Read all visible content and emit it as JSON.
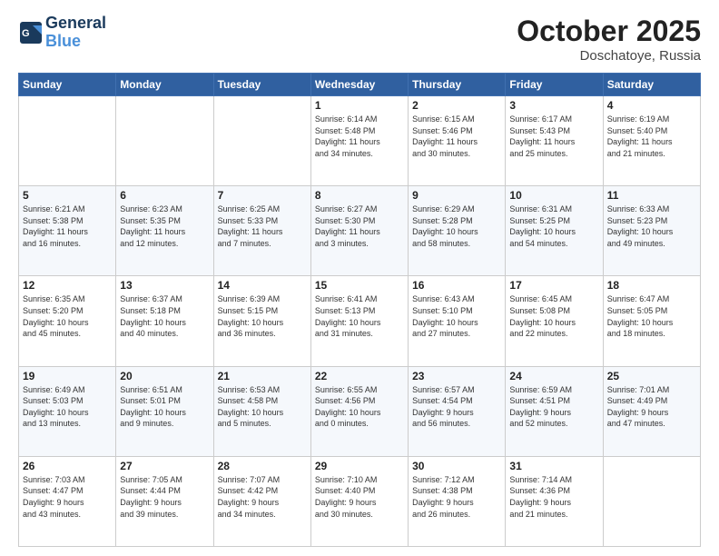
{
  "header": {
    "logo_line1": "General",
    "logo_line2": "Blue",
    "month": "October 2025",
    "location": "Doschatoye, Russia"
  },
  "weekdays": [
    "Sunday",
    "Monday",
    "Tuesday",
    "Wednesday",
    "Thursday",
    "Friday",
    "Saturday"
  ],
  "weeks": [
    [
      {
        "day": "",
        "info": ""
      },
      {
        "day": "",
        "info": ""
      },
      {
        "day": "",
        "info": ""
      },
      {
        "day": "1",
        "info": "Sunrise: 6:14 AM\nSunset: 5:48 PM\nDaylight: 11 hours\nand 34 minutes."
      },
      {
        "day": "2",
        "info": "Sunrise: 6:15 AM\nSunset: 5:46 PM\nDaylight: 11 hours\nand 30 minutes."
      },
      {
        "day": "3",
        "info": "Sunrise: 6:17 AM\nSunset: 5:43 PM\nDaylight: 11 hours\nand 25 minutes."
      },
      {
        "day": "4",
        "info": "Sunrise: 6:19 AM\nSunset: 5:40 PM\nDaylight: 11 hours\nand 21 minutes."
      }
    ],
    [
      {
        "day": "5",
        "info": "Sunrise: 6:21 AM\nSunset: 5:38 PM\nDaylight: 11 hours\nand 16 minutes."
      },
      {
        "day": "6",
        "info": "Sunrise: 6:23 AM\nSunset: 5:35 PM\nDaylight: 11 hours\nand 12 minutes."
      },
      {
        "day": "7",
        "info": "Sunrise: 6:25 AM\nSunset: 5:33 PM\nDaylight: 11 hours\nand 7 minutes."
      },
      {
        "day": "8",
        "info": "Sunrise: 6:27 AM\nSunset: 5:30 PM\nDaylight: 11 hours\nand 3 minutes."
      },
      {
        "day": "9",
        "info": "Sunrise: 6:29 AM\nSunset: 5:28 PM\nDaylight: 10 hours\nand 58 minutes."
      },
      {
        "day": "10",
        "info": "Sunrise: 6:31 AM\nSunset: 5:25 PM\nDaylight: 10 hours\nand 54 minutes."
      },
      {
        "day": "11",
        "info": "Sunrise: 6:33 AM\nSunset: 5:23 PM\nDaylight: 10 hours\nand 49 minutes."
      }
    ],
    [
      {
        "day": "12",
        "info": "Sunrise: 6:35 AM\nSunset: 5:20 PM\nDaylight: 10 hours\nand 45 minutes."
      },
      {
        "day": "13",
        "info": "Sunrise: 6:37 AM\nSunset: 5:18 PM\nDaylight: 10 hours\nand 40 minutes."
      },
      {
        "day": "14",
        "info": "Sunrise: 6:39 AM\nSunset: 5:15 PM\nDaylight: 10 hours\nand 36 minutes."
      },
      {
        "day": "15",
        "info": "Sunrise: 6:41 AM\nSunset: 5:13 PM\nDaylight: 10 hours\nand 31 minutes."
      },
      {
        "day": "16",
        "info": "Sunrise: 6:43 AM\nSunset: 5:10 PM\nDaylight: 10 hours\nand 27 minutes."
      },
      {
        "day": "17",
        "info": "Sunrise: 6:45 AM\nSunset: 5:08 PM\nDaylight: 10 hours\nand 22 minutes."
      },
      {
        "day": "18",
        "info": "Sunrise: 6:47 AM\nSunset: 5:05 PM\nDaylight: 10 hours\nand 18 minutes."
      }
    ],
    [
      {
        "day": "19",
        "info": "Sunrise: 6:49 AM\nSunset: 5:03 PM\nDaylight: 10 hours\nand 13 minutes."
      },
      {
        "day": "20",
        "info": "Sunrise: 6:51 AM\nSunset: 5:01 PM\nDaylight: 10 hours\nand 9 minutes."
      },
      {
        "day": "21",
        "info": "Sunrise: 6:53 AM\nSunset: 4:58 PM\nDaylight: 10 hours\nand 5 minutes."
      },
      {
        "day": "22",
        "info": "Sunrise: 6:55 AM\nSunset: 4:56 PM\nDaylight: 10 hours\nand 0 minutes."
      },
      {
        "day": "23",
        "info": "Sunrise: 6:57 AM\nSunset: 4:54 PM\nDaylight: 9 hours\nand 56 minutes."
      },
      {
        "day": "24",
        "info": "Sunrise: 6:59 AM\nSunset: 4:51 PM\nDaylight: 9 hours\nand 52 minutes."
      },
      {
        "day": "25",
        "info": "Sunrise: 7:01 AM\nSunset: 4:49 PM\nDaylight: 9 hours\nand 47 minutes."
      }
    ],
    [
      {
        "day": "26",
        "info": "Sunrise: 7:03 AM\nSunset: 4:47 PM\nDaylight: 9 hours\nand 43 minutes."
      },
      {
        "day": "27",
        "info": "Sunrise: 7:05 AM\nSunset: 4:44 PM\nDaylight: 9 hours\nand 39 minutes."
      },
      {
        "day": "28",
        "info": "Sunrise: 7:07 AM\nSunset: 4:42 PM\nDaylight: 9 hours\nand 34 minutes."
      },
      {
        "day": "29",
        "info": "Sunrise: 7:10 AM\nSunset: 4:40 PM\nDaylight: 9 hours\nand 30 minutes."
      },
      {
        "day": "30",
        "info": "Sunrise: 7:12 AM\nSunset: 4:38 PM\nDaylight: 9 hours\nand 26 minutes."
      },
      {
        "day": "31",
        "info": "Sunrise: 7:14 AM\nSunset: 4:36 PM\nDaylight: 9 hours\nand 21 minutes."
      },
      {
        "day": "",
        "info": ""
      }
    ]
  ]
}
